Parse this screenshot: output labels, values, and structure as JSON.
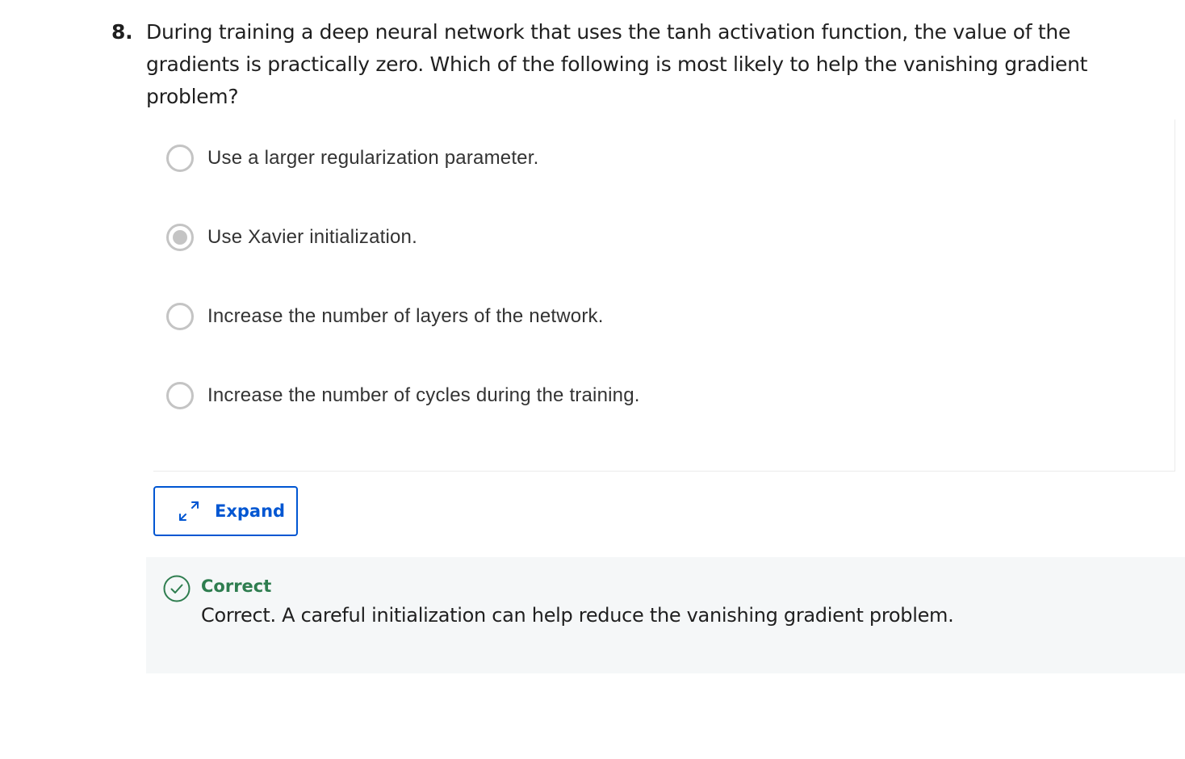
{
  "question": {
    "number": "8.",
    "text": "During training a deep neural network that uses the tanh activation function, the value of the gradients is practically zero. Which of the following is most likely to help the vanishing gradient problem?"
  },
  "options": [
    {
      "label": "Use a larger regularization parameter.",
      "selected": false
    },
    {
      "label": "Use Xavier initialization.",
      "selected": true
    },
    {
      "label": "Increase the number of layers of the network.",
      "selected": false
    },
    {
      "label": "Increase the number of cycles during the training.",
      "selected": false
    }
  ],
  "expand": {
    "label": "Expand",
    "icon": "expand-arrows-icon"
  },
  "feedback": {
    "icon": "check-circle-icon",
    "title": "Correct",
    "text": "Correct. A careful initialization can help reduce the vanishing gradient problem."
  },
  "colors": {
    "accent": "#0056d2",
    "success": "#2e7d4f",
    "radio": "#c4c4c4",
    "feedback_bg": "#f5f7f8"
  }
}
